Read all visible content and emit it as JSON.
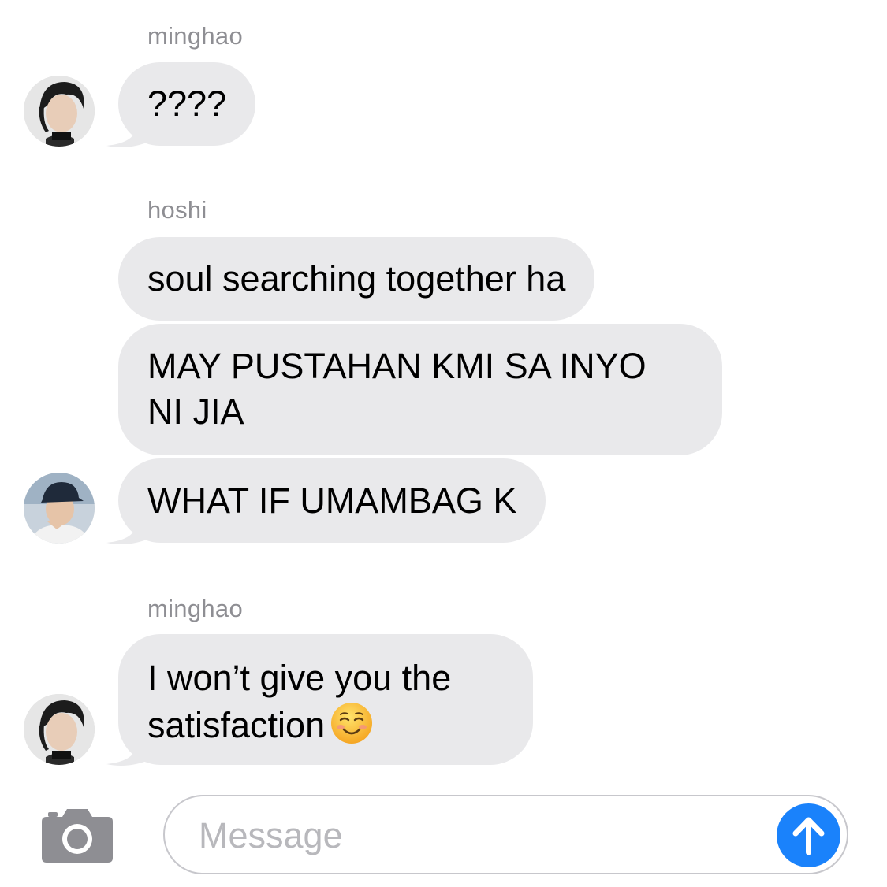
{
  "messages": [
    {
      "sender": "minghao",
      "bubbles": [
        "????"
      ]
    },
    {
      "sender": "hoshi",
      "bubbles": [
        "soul searching together ha",
        "MAY PUSTAHAN KMI SA INYO\nNI JIA",
        "WHAT IF UMAMBAG K"
      ]
    },
    {
      "sender": "minghao",
      "bubbles": [
        "I won’t give you the\nsatisfaction"
      ]
    }
  ],
  "emoji_name": "smiling-face-emoji",
  "composer": {
    "placeholder": "Message",
    "camera_icon": "camera-icon",
    "send_icon": "arrow-up-icon"
  },
  "colors": {
    "bubble_bg": "#e9e9eb",
    "sender_name": "#8e8e93",
    "send_button": "#1a82fb",
    "camera": "#8e8e93"
  }
}
